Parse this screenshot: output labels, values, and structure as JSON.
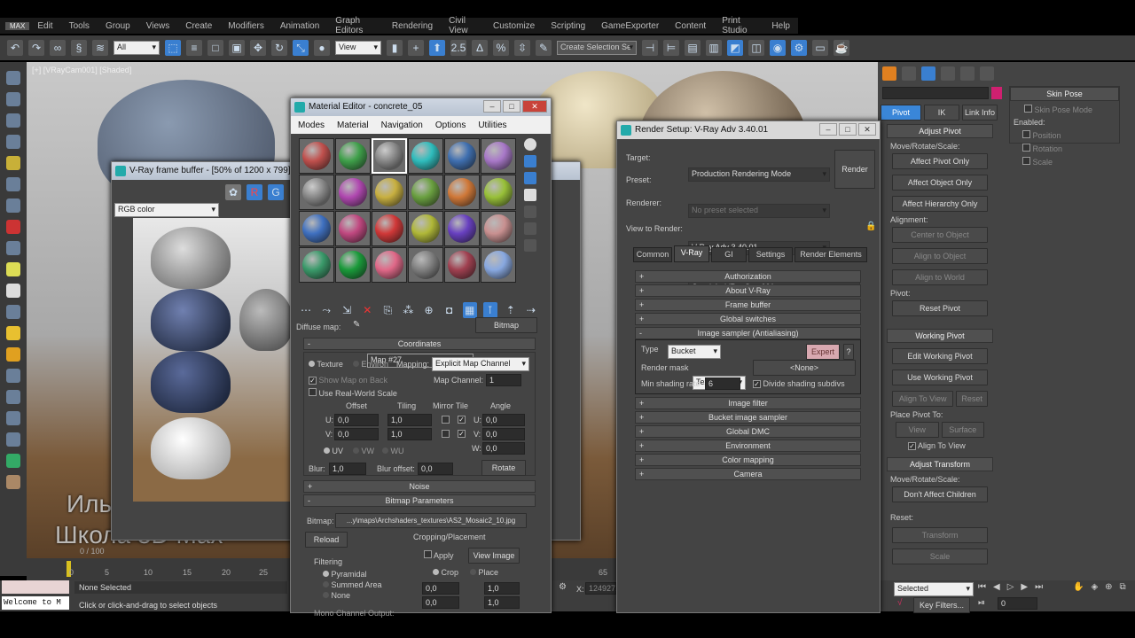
{
  "menubar": {
    "logo": "MAX",
    "items": [
      "Edit",
      "Tools",
      "Group",
      "Views",
      "Create",
      "Modifiers",
      "Animation",
      "Graph Editors",
      "Rendering",
      "Civil View",
      "Customize",
      "Scripting",
      "GameExporter",
      "Content",
      "Print Studio",
      "Help"
    ]
  },
  "toolbar": {
    "selection_filter": "All",
    "ref_coord": "View",
    "snap_angle": "2.5",
    "selection_set": "Create Selection Se"
  },
  "viewport": {
    "label": "[+] [VRayCam001] [Shaded]"
  },
  "vfb": {
    "title": "V-Ray frame buffer - [50% of 1200 x 799]",
    "channel": "RGB color",
    "r": "R",
    "g": "G"
  },
  "material_editor": {
    "title": "Material Editor - concrete_05",
    "menu": [
      "Modes",
      "Material",
      "Navigation",
      "Options",
      "Utilities"
    ],
    "sphere_colors": [
      "#c0504d",
      "#3fa04a",
      "checker",
      "#2fbdbd",
      "#3f6fb0",
      "#a878c8",
      "checker",
      "#b048b0",
      "#c8b040",
      "#6aa040",
      "#d07838",
      "#98c038",
      "#3f70c0",
      "#c04880",
      "#d03838",
      "#b0b838",
      "#6840c0",
      "#c89090",
      "#3a9a6a",
      "#1a9a3a",
      "#e06888",
      "#808080",
      "#a04050",
      "#88a8e0"
    ],
    "diffuse_label": "Diffuse map:",
    "map_name": "Map #27",
    "map_type": "Bitmap",
    "coords": {
      "title": "Coordinates",
      "texture": "Texture",
      "environ": "Environ",
      "mapping_label": "Mapping:",
      "mapping": "Explicit Map Channel",
      "show_map_on_back": "Show Map on Back",
      "map_channel_label": "Map Channel:",
      "map_channel": "1",
      "real_world": "Use Real-World Scale",
      "offset": "Offset",
      "tiling": "Tiling",
      "mirror_tile": "Mirror Tile",
      "angle": "Angle",
      "u": "U:",
      "v": "V:",
      "w": "W:",
      "offset_u": "0,0",
      "offset_v": "0,0",
      "tiling_u": "1,0",
      "tiling_v": "1,0",
      "angle_u": "0,0",
      "angle_v": "0,0",
      "angle_w": "0,0",
      "uv": "UV",
      "vw": "VW",
      "wu": "WU",
      "blur_label": "Blur:",
      "blur": "1,0",
      "blur_offset_label": "Blur offset:",
      "blur_offset": "0,0",
      "rotate": "Rotate"
    },
    "noise": "Noise",
    "bitmap_params": {
      "title": "Bitmap Parameters",
      "bitmap_label": "Bitmap:",
      "path": "...y\\maps\\Archshaders_textures\\AS2_Mosaic2_10.jpg",
      "reload": "Reload",
      "filtering": "Filtering",
      "pyramidal": "Pyramidal",
      "summed": "Summed Area",
      "none": "None",
      "cropping": "Cropping/Placement",
      "apply": "Apply",
      "view_image": "View Image",
      "crop": "Crop",
      "place": "Place",
      "u": "0,0",
      "v": "0,0",
      "w": "1,0",
      "h": "1,0",
      "mono": "Mono Channel Output:"
    }
  },
  "render_setup": {
    "title": "Render Setup: V-Ray Adv 3.40.01",
    "target_label": "Target:",
    "target": "Production Rendering Mode",
    "preset_label": "Preset:",
    "preset": "No preset selected",
    "renderer_label": "Renderer:",
    "renderer": "V-Ray Adv 3.40.01",
    "view_label": "View to Render:",
    "view": "Quad 4 - VRayCam001",
    "render": "Render",
    "tabs": [
      "Common",
      "V-Ray",
      "GI",
      "Settings",
      "Render Elements"
    ],
    "rollouts_top": [
      "Authorization",
      "About V-Ray",
      "Frame buffer",
      "Global switches"
    ],
    "sampler": {
      "title": "Image sampler (Antialiasing)",
      "type_label": "Type",
      "type": "Bucket",
      "expert": "Expert",
      "help": "?",
      "mask_label": "Render mask",
      "mask": "Texture",
      "none": "<None>",
      "rate_label": "Min shading rate",
      "rate": "6",
      "divide": "Divide shading subdivs"
    },
    "rollouts_bottom": [
      "Image filter",
      "Bucket image sampler",
      "Global DMC",
      "Environment",
      "Color mapping",
      "Camera"
    ]
  },
  "command_panel": {
    "tabs": [
      "Pivot",
      "IK",
      "Link Info"
    ],
    "adjust_pivot": "Adjust Pivot",
    "mrs": "Move/Rotate/Scale:",
    "affect_pivot": "Affect Pivot Only",
    "affect_object": "Affect Object Only",
    "affect_hierarchy": "Affect Hierarchy Only",
    "alignment": "Alignment:",
    "center": "Center to Object",
    "align_obj": "Align to Object",
    "align_world": "Align to World",
    "pivot": "Pivot:",
    "reset_pivot": "Reset Pivot",
    "working_pivot": "Working Pivot",
    "edit_wp": "Edit Working Pivot",
    "use_wp": "Use Working Pivot",
    "align_view": "Align To View",
    "reset": "Reset",
    "place_to": "Place Pivot To:",
    "view": "View",
    "surface": "Surface",
    "align_to_view": "Align To View",
    "adjust_transform": "Adjust Transform",
    "dont_affect": "Don't Affect Children",
    "reset_label": "Reset:",
    "transform": "Transform",
    "scale": "Scale",
    "skin_pose": "Skin Pose",
    "skin_pose_mode": "Skin Pose Mode",
    "enabled": "Enabled:",
    "position": "Position",
    "rotation": "Rotation",
    "scale2": "Scale"
  },
  "timeline": {
    "frame": "0 / 100",
    "ticks": [
      "0",
      "5",
      "10",
      "15",
      "20",
      "25",
      "65",
      "70"
    ]
  },
  "status": {
    "welcome": "Welcome to M",
    "selection": "None Selected",
    "prompt": "Click or click-and-drag to select objects",
    "x_label": "X:",
    "x_value": "124927,",
    "key_mode": "Selected",
    "key_filters": "Key Filters...",
    "frame": "0"
  },
  "watermark": {
    "line1": "Илья Изотов",
    "line2": "Школа 3D Max"
  }
}
